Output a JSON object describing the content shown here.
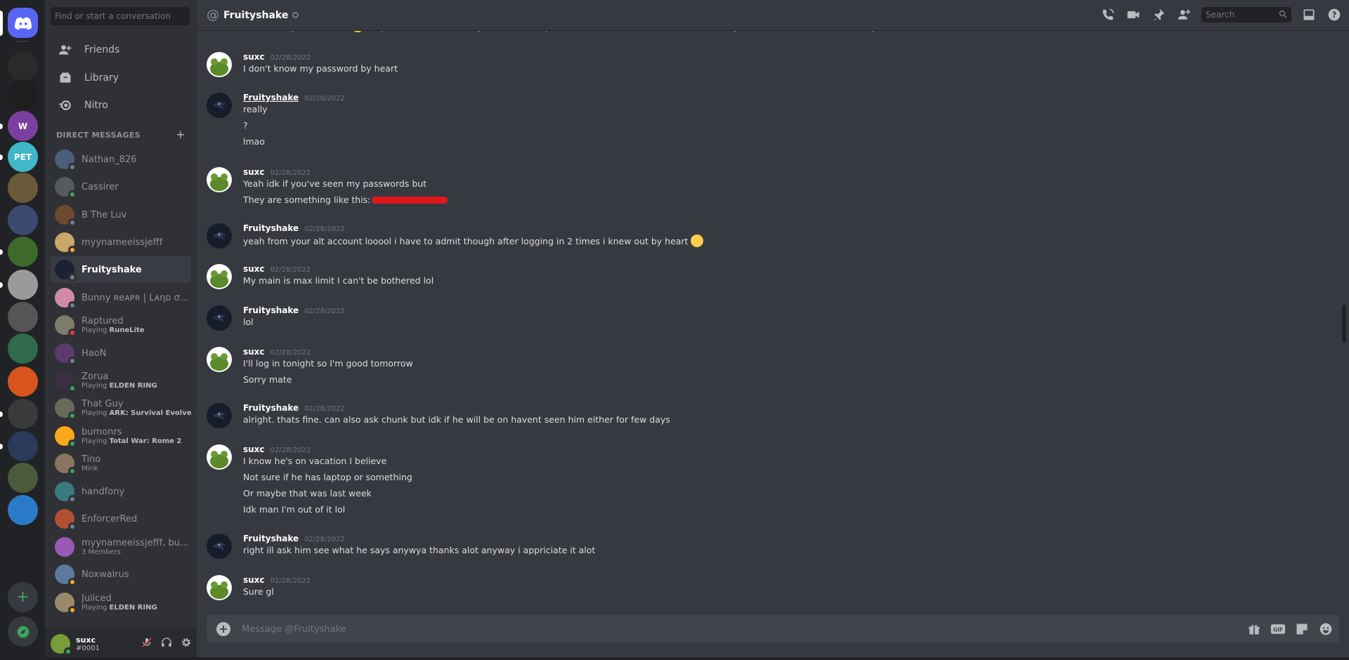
{
  "sidebar": {
    "search_placeholder": "Find or start a conversation",
    "nav": [
      {
        "label": "Friends"
      },
      {
        "label": "Library"
      },
      {
        "label": "Nitro"
      }
    ],
    "dm_header": "DIRECT MESSAGES",
    "dms": [
      {
        "name": "Nathan_826",
        "sub": "",
        "game": "",
        "status": "offline",
        "color": "#4a5f7a"
      },
      {
        "name": "Cassirer",
        "sub": "",
        "game": "",
        "status": "online",
        "color": "#555a60"
      },
      {
        "name": "B The Luv",
        "sub": "",
        "game": "",
        "status": "offline",
        "color": "#6b4a2e"
      },
      {
        "name": "myynameeissjefff",
        "sub": "",
        "game": "",
        "status": "idle",
        "color": "#c8a868"
      },
      {
        "name": "Fruityshake",
        "sub": "",
        "game": "",
        "status": "offline",
        "color": "#1b2233"
      },
      {
        "name": "Bunny ʀeᴀᴘʀ | Lᴀηᴅ σ...",
        "sub": "",
        "game": "",
        "status": "offline",
        "color": "#d08aa8"
      },
      {
        "name": "Raptured",
        "sub": "Playing ",
        "game": "RuneLite",
        "status": "dnd",
        "color": "#7d7d6a"
      },
      {
        "name": "HaoN",
        "sub": "",
        "game": "",
        "status": "offline",
        "color": "#5c3a6e"
      },
      {
        "name": "Zorua",
        "sub": "Playing ",
        "game": "ELDEN RING",
        "status": "online",
        "color": "#3a2e40"
      },
      {
        "name": "That Guy",
        "sub": "Playing ",
        "game": "ARK: Survival Evolved",
        "status": "online",
        "color": "#6a6a5a"
      },
      {
        "name": "bumonrs",
        "sub": "Playing ",
        "game": "Total War: Rome 2",
        "status": "online",
        "color": "#faa81a"
      },
      {
        "name": "Tino",
        "sub": "Mink",
        "game": "",
        "status": "online",
        "color": "#8a7560"
      },
      {
        "name": "handfony",
        "sub": "",
        "game": "",
        "status": "offline",
        "color": "#3a7a7e"
      },
      {
        "name": "EnforcerRed",
        "sub": "",
        "game": "",
        "status": "offline",
        "color": "#b05030"
      },
      {
        "name": "myynameeissjefff, bu...",
        "sub": "3 Members",
        "game": "",
        "status": "",
        "color": "#9b59b6"
      },
      {
        "name": "Noxwalrus",
        "sub": "",
        "game": "",
        "status": "idle",
        "color": "#5b7a9e"
      },
      {
        "name": "Juiiced",
        "sub": "Playing ",
        "game": "ELDEN RING",
        "status": "idle",
        "color": "#9a8a6a"
      }
    ]
  },
  "user": {
    "name": "suxc",
    "tag": "#0001"
  },
  "channel": {
    "name": "Fruityshake",
    "search_placeholder": "Search"
  },
  "messages": [
    {
      "author": "",
      "date": "",
      "lines": [
        {
          "text": "ah well all good too bad",
          "emoji": true,
          "after": "maybe nexttime when u got time its okay let me know how much colat i need though so i can least have that ready"
        }
      ]
    },
    {
      "author": "suxc",
      "date": "02/28/2022",
      "lines": [
        {
          "text": "I don't know my password by heart"
        }
      ]
    },
    {
      "author": "Fruityshake",
      "date": "02/28/2022",
      "underline": true,
      "lines": [
        {
          "text": "really"
        },
        {
          "text": "?"
        },
        {
          "text": "lmao"
        }
      ]
    },
    {
      "author": "suxc",
      "date": "02/28/2022",
      "lines": [
        {
          "text": "Yeah idk if you've seen my passwords but"
        },
        {
          "text": "They are something like this:",
          "redacted": true
        }
      ]
    },
    {
      "author": "Fruityshake",
      "date": "02/28/2022",
      "lines": [
        {
          "text": "yeah from your alt account looool i have to admit though after logging in 2 times i knew out by heart",
          "emoji": true
        }
      ]
    },
    {
      "author": "suxc",
      "date": "02/28/2022",
      "lines": [
        {
          "text": "My main is max limit I can't be bothered lol"
        }
      ]
    },
    {
      "author": "Fruityshake",
      "date": "02/28/2022",
      "lines": [
        {
          "text": "lol"
        }
      ]
    },
    {
      "author": "suxc",
      "date": "02/28/2022",
      "lines": [
        {
          "text": "I'll log in tonight so I'm good tomorrow"
        },
        {
          "text": "Sorry mate"
        }
      ]
    },
    {
      "author": "Fruityshake",
      "date": "02/28/2022",
      "lines": [
        {
          "text": "alright. thats fine. can also ask chunk but idk if he will be on havent seen him either for few  days"
        }
      ]
    },
    {
      "author": "suxc",
      "date": "02/28/2022",
      "lines": [
        {
          "text": "I know he's on vacation I believe"
        },
        {
          "text": "Not sure if he has laptop or something"
        },
        {
          "text": "Or maybe that was last week"
        },
        {
          "text": "Idk man I'm out of it lol"
        }
      ]
    },
    {
      "author": "Fruityshake",
      "date": "02/28/2022",
      "lines": [
        {
          "text": "right ill ask him see what he says anywya thanks alot anyway i appriciate it alot"
        }
      ]
    },
    {
      "author": "suxc",
      "date": "02/28/2022",
      "lines": [
        {
          "text": "Sure gl"
        }
      ]
    }
  ],
  "composer": {
    "placeholder": "Message @Fruityshake"
  },
  "servers": [
    {
      "label": "",
      "color": "#5865f2"
    },
    {
      "label": "",
      "color": "#2a2a2a"
    },
    {
      "label": "",
      "color": "#1e1e1e"
    },
    {
      "label": "W",
      "color": "#7b3fa0"
    },
    {
      "label": "PET",
      "color": "#3fb7c7"
    },
    {
      "label": "",
      "color": "#6a5a3a"
    },
    {
      "label": "",
      "color": "#3b4a70"
    },
    {
      "label": "",
      "color": "#3d6a2a"
    },
    {
      "label": "",
      "color": "#9a9a9a"
    },
    {
      "label": "",
      "color": "#555"
    },
    {
      "label": "",
      "color": "#2f6a4a"
    },
    {
      "label": "",
      "color": "#d8541c"
    },
    {
      "label": "",
      "color": "#3a3a3a"
    },
    {
      "label": "",
      "color": "#2a3a5a"
    },
    {
      "label": "",
      "color": "#4a5a3a"
    },
    {
      "label": "",
      "color": "#2a7ac8"
    }
  ]
}
